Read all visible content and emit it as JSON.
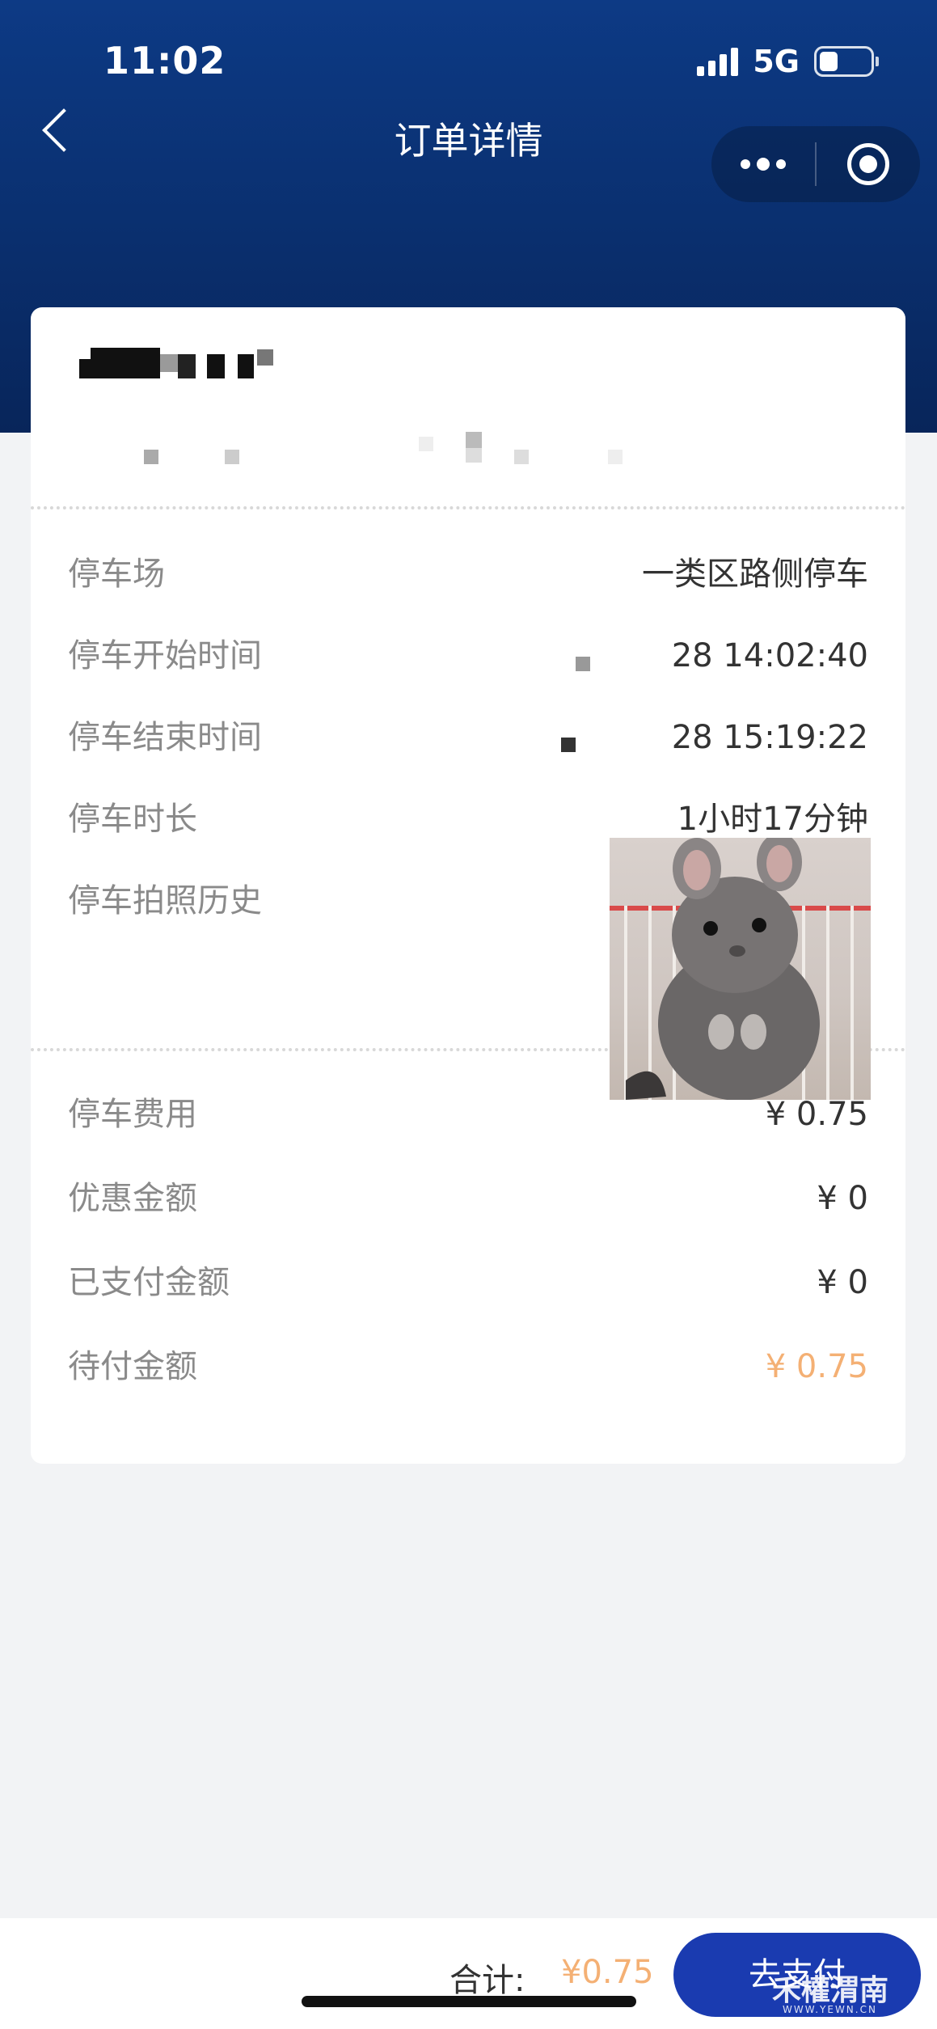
{
  "status_bar": {
    "time": "11:02",
    "network": "5G",
    "battery_level": 0.35
  },
  "nav": {
    "title": "订单详情",
    "back_icon": "chevron-left-icon",
    "more_icon": "more-dots-icon",
    "close_icon": "target-circle-icon"
  },
  "order": {
    "rows": [
      {
        "label": "停车场",
        "value": "一类区路侧停车"
      },
      {
        "label": "停车开始时间",
        "value": "28 14:02:40"
      },
      {
        "label": "停车结束时间",
        "value": "28 15:19:22"
      },
      {
        "label": "停车时长",
        "value": "1小时17分钟"
      },
      {
        "label": "停车拍照历史",
        "value": ""
      }
    ],
    "fees": [
      {
        "label": "停车费用",
        "value": "¥ 0.75"
      },
      {
        "label": "优惠金额",
        "value": "¥ 0"
      },
      {
        "label": "已支付金额",
        "value": "¥ 0"
      },
      {
        "label": "待付金额",
        "value": "¥ 0.75"
      }
    ]
  },
  "footer": {
    "total_label": "合计:",
    "total_value": "¥0.75",
    "pay_label": "去支付",
    "watermark": "禾權渭南",
    "watermark_sub": "WWW.YEWN.CN"
  },
  "colors": {
    "header_blue": "#0d3a85",
    "accent_orange": "#f4b074",
    "pay_button": "#1a3bb0"
  }
}
